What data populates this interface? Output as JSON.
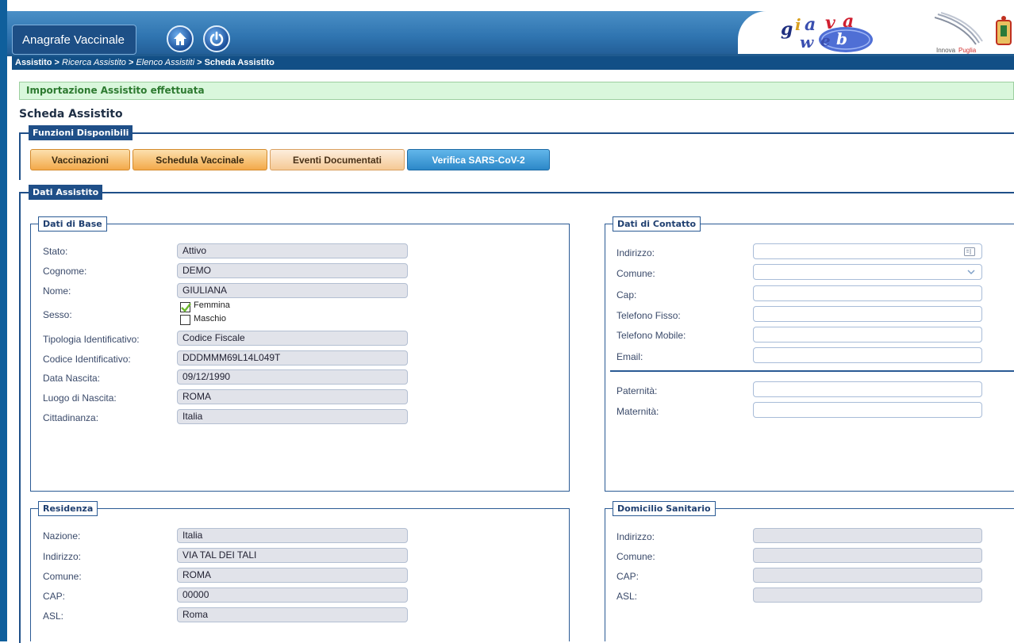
{
  "app": {
    "title": "Anagrafe Vaccinale"
  },
  "breadcrumb": {
    "b1": "Assistito",
    "sep": " > ",
    "b2": "Ricerca Assistito",
    "b3": "Elenco Assistiti",
    "b4": "Scheda Assistito"
  },
  "logos": {
    "giava": "giava web",
    "innova": "InnovaPuglia"
  },
  "message": "Importazione Assistito effettuata",
  "page_title": "Scheda Assistito",
  "funzioni": {
    "legend": "Funzioni Disponibili",
    "buttons": [
      "Vaccinazioni",
      "Schedula Vaccinale",
      "Eventi Documentati",
      "Verifica SARS-CoV-2"
    ]
  },
  "dati_assistito": {
    "legend": "Dati Assistito"
  },
  "dati_base": {
    "legend": "Dati di Base",
    "labels": [
      "Stato:",
      "Cognome:",
      "Nome:",
      "Sesso:",
      "Tipologia Identificativo:",
      "Codice Identificativo:",
      "Data Nascita:",
      "Luogo di Nascita:",
      "Cittadinanza:"
    ],
    "values": {
      "stato": "Attivo",
      "cognome": "DEMO",
      "nome": "GIULIANA",
      "tipologia": "Codice Fiscale",
      "codice": "DDDMMM69L14L049T",
      "data_nascita": "09/12/1990",
      "luogo_nascita": "ROMA",
      "cittadinanza": "Italia"
    },
    "sesso": {
      "femmina": "Femmina",
      "maschio": "Maschio",
      "selected": "Femmina"
    }
  },
  "contatto": {
    "legend": "Dati di Contatto",
    "labels": [
      "Indirizzo:",
      "Comune:",
      "Cap:",
      "Telefono Fisso:",
      "Telefono Mobile:",
      "Email:",
      "Paternità:",
      "Maternità:"
    ]
  },
  "residenza": {
    "legend": "Residenza",
    "labels": [
      "Nazione:",
      "Indirizzo:",
      "Comune:",
      "CAP:",
      "ASL:"
    ],
    "values": [
      "Italia",
      "VIA TAL DEI TALI",
      "ROMA",
      "00000",
      "Roma"
    ]
  },
  "domicilio": {
    "legend": "Domicilio Sanitario",
    "labels": [
      "Indirizzo:",
      "Comune:",
      "CAP:",
      "ASL:"
    ]
  },
  "colors": {
    "header_blue": "#2f74b0",
    "dark_blue": "#1f4f88",
    "success_bg": "#d9f7dc",
    "orange": "#f3a94a",
    "button_blue": "#2c88c8"
  }
}
